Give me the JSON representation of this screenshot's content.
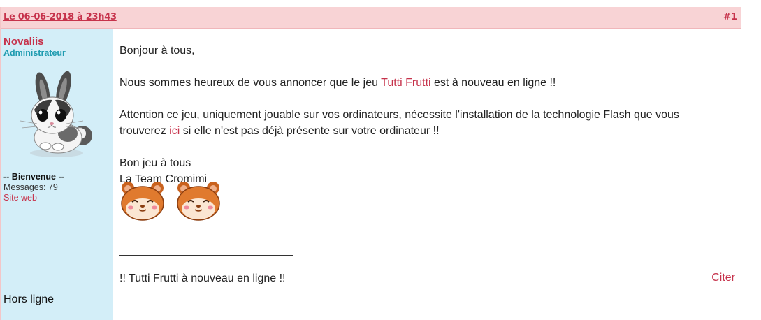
{
  "post": {
    "date": "Le 06-06-2018 à 23h43",
    "number": "#1",
    "quote_label": "Citer"
  },
  "author": {
    "name": "Novaliis",
    "rank": "Administrateur",
    "welcome": "-- Bienvenue --",
    "messages": "Messages: 79",
    "website": "Site web",
    "status": "Hors ligne"
  },
  "message": {
    "greeting": "Bonjour à tous,",
    "p1_before": "Nous sommes heureux de vous annoncer que le jeu ",
    "p1_link": "Tutti Frutti",
    "p1_after": " est à nouveau en ligne !!",
    "p2_line1": "Attention ce jeu, uniquement jouable sur vos ordinateurs, nécessite l'installation de la technologie Flash que vous",
    "p2_before": "trouverez ",
    "p2_link": "ici",
    "p2_after": " si elle n'est pas déjà présente sur votre ordinateur !!",
    "closing1": "Bon jeu à tous",
    "closing2": "La Team Cromimi",
    "signature": "!! Tutti Frutti à nouveau en ligne !!"
  },
  "icons": {
    "avatar": "bunny-avatar",
    "smiley": "hamster-smiley-icon"
  },
  "colors": {
    "header_bg": "#f8d3d5",
    "sidebar_bg": "#d3eef8",
    "accent": "#c6324b",
    "rank": "#1e9bb0"
  }
}
